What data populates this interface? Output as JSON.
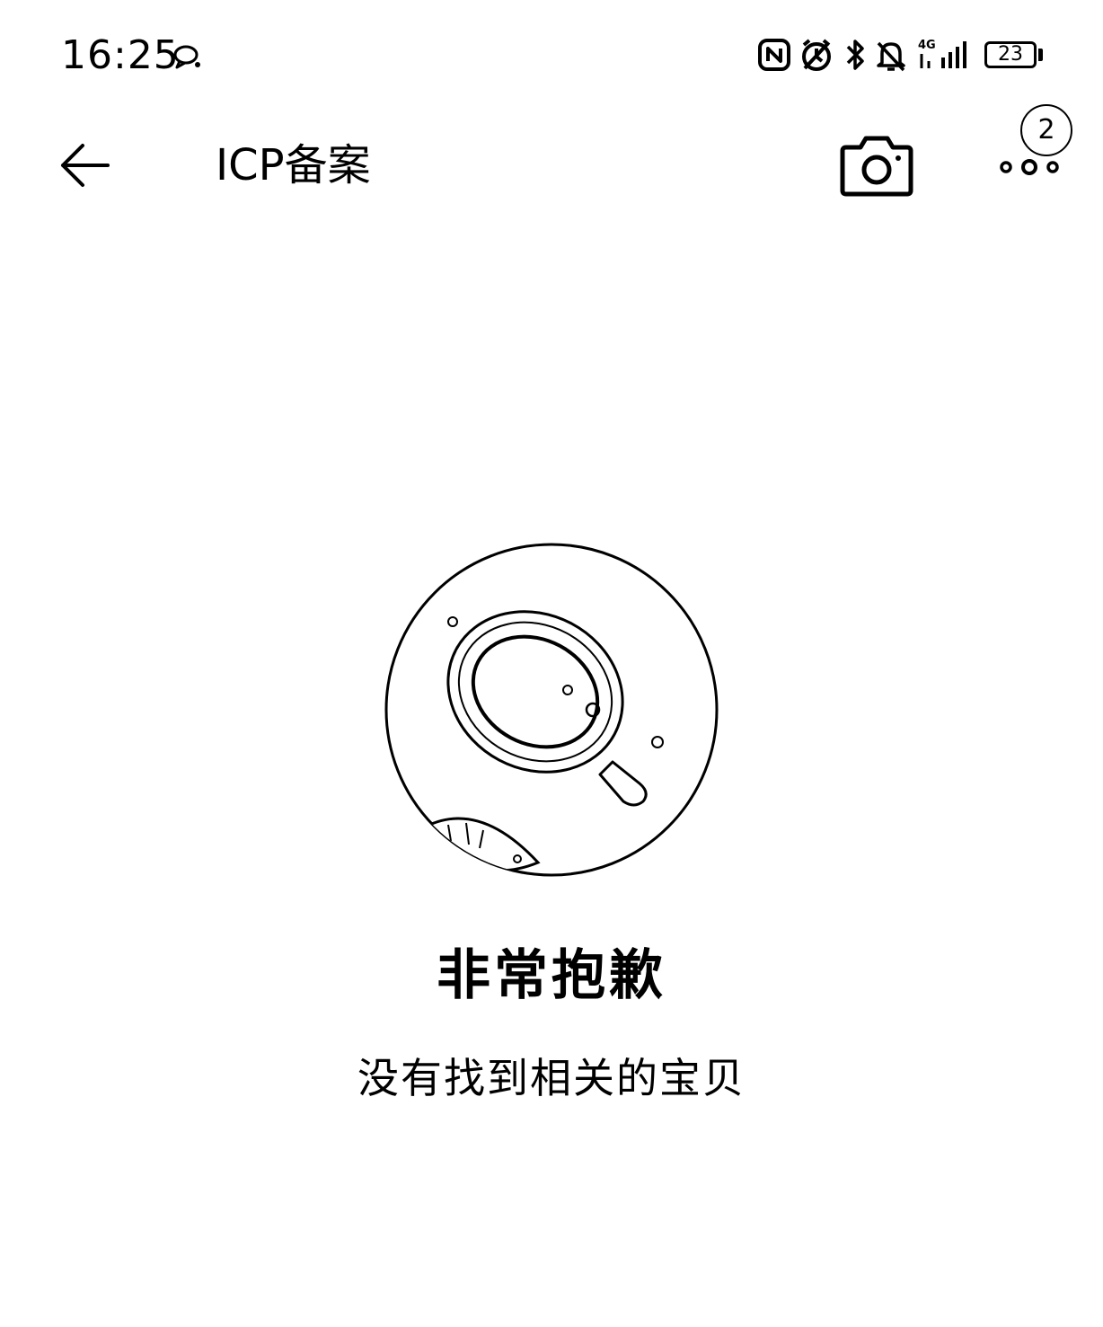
{
  "status_bar": {
    "time": "16:25",
    "battery_level": "23",
    "network_label": "4G",
    "icons": [
      "chat-bubble-icon",
      "nfc-icon",
      "alarm-icon",
      "bluetooth-icon",
      "mute-bell-icon",
      "signal-icon",
      "battery-icon"
    ]
  },
  "header": {
    "title": "ICP备案",
    "back_icon": "arrow-left-icon",
    "camera_icon": "camera-icon",
    "more_icon": "more-dots-icon",
    "more_badge": "2"
  },
  "empty_state": {
    "title": "非常抱歉",
    "subtitle": "没有找到相关的宝贝",
    "illustration": "magnifier-empty-illustration"
  }
}
